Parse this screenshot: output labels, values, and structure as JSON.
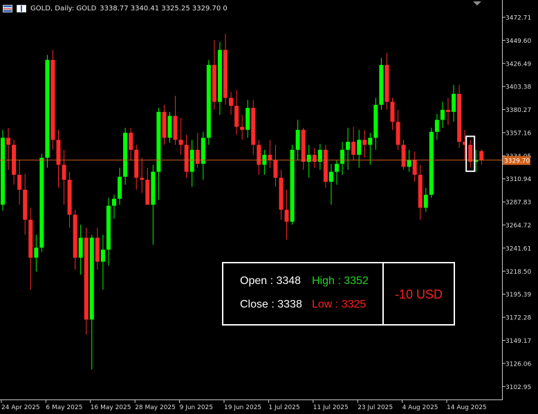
{
  "header": {
    "symbol_title": "GOLD, Daily:  GOLD",
    "ohlc_values": "3338.77 3340.41 3325.25 3329.70  0"
  },
  "colors": {
    "background": "#000000",
    "bull": "#00ff00",
    "bear": "#ff2a2a",
    "axis_text": "#dcdcdc",
    "price_line": "#d2601a",
    "price_tag_bg": "#d2601a"
  },
  "info_box": {
    "open_label": "Open : 3348",
    "high_label": "High : 3352",
    "close_label": "Close : 3338",
    "low_label": "Low : 3325",
    "pnl_label": "-10 USD"
  },
  "chart_data": {
    "type": "candlestick",
    "ylim": [
      3090,
      3490
    ],
    "y_ticks": [
      3472.71,
      3449.6,
      3426.49,
      3403.38,
      3380.27,
      3357.16,
      3334.05,
      3310.94,
      3287.83,
      3264.72,
      3241.61,
      3218.5,
      3195.39,
      3172.28,
      3149.17,
      3126.06,
      3102.95
    ],
    "x_tick_labels": [
      "24 Apr 2025",
      "6 May 2025",
      "16 May 2025",
      "28 May 2025",
      "9 Jun 2025",
      "19 Jun 2025",
      "1 Jul 2025",
      "11 Jul 2025",
      "23 Jul 2025",
      "4 Aug 2025",
      "14 Aug 2025"
    ],
    "x_tick_index": [
      0,
      8,
      16,
      24,
      32,
      40,
      48,
      56,
      64,
      72,
      80
    ],
    "current_price": 3329.7,
    "highlight_index": 84,
    "candles": [
      [
        3285,
        3360,
        3279,
        3352
      ],
      [
        3352,
        3362,
        3320,
        3345
      ],
      [
        3345,
        3350,
        3305,
        3315
      ],
      [
        3315,
        3330,
        3285,
        3300
      ],
      [
        3300,
        3316,
        3255,
        3270
      ],
      [
        3270,
        3282,
        3200,
        3232
      ],
      [
        3232,
        3255,
        3218,
        3242
      ],
      [
        3242,
        3336,
        3238,
        3332
      ],
      [
        3332,
        3435,
        3322,
        3430
      ],
      [
        3430,
        3440,
        3340,
        3350
      ],
      [
        3350,
        3360,
        3302,
        3325
      ],
      [
        3325,
        3340,
        3285,
        3310
      ],
      [
        3310,
        3318,
        3262,
        3275
      ],
      [
        3275,
        3280,
        3220,
        3232
      ],
      [
        3232,
        3265,
        3215,
        3252
      ],
      [
        3252,
        3262,
        3155,
        3170
      ],
      [
        3170,
        3255,
        3120,
        3252
      ],
      [
        3252,
        3262,
        3220,
        3228
      ],
      [
        3228,
        3255,
        3200,
        3240
      ],
      [
        3240,
        3292,
        3224,
        3284
      ],
      [
        3284,
        3295,
        3271,
        3291
      ],
      [
        3291,
        3322,
        3285,
        3313
      ],
      [
        3313,
        3362,
        3305,
        3357
      ],
      [
        3357,
        3362,
        3330,
        3340
      ],
      [
        3340,
        3345,
        3300,
        3312
      ],
      [
        3312,
        3332,
        3297,
        3310
      ],
      [
        3310,
        3322,
        3290,
        3285
      ],
      [
        3285,
        3325,
        3245,
        3318
      ],
      [
        3318,
        3382,
        3290,
        3378
      ],
      [
        3378,
        3385,
        3345,
        3352
      ],
      [
        3352,
        3378,
        3347,
        3374
      ],
      [
        3374,
        3394,
        3345,
        3350
      ],
      [
        3350,
        3372,
        3335,
        3345
      ],
      [
        3345,
        3355,
        3312,
        3318
      ],
      [
        3318,
        3350,
        3303,
        3340
      ],
      [
        3340,
        3357,
        3322,
        3326
      ],
      [
        3326,
        3358,
        3310,
        3352
      ],
      [
        3352,
        3430,
        3345,
        3425
      ],
      [
        3425,
        3450,
        3380,
        3388
      ],
      [
        3388,
        3448,
        3375,
        3440
      ],
      [
        3440,
        3456,
        3385,
        3392
      ],
      [
        3392,
        3398,
        3375,
        3384
      ],
      [
        3384,
        3400,
        3355,
        3363
      ],
      [
        3363,
        3375,
        3350,
        3360
      ],
      [
        3360,
        3390,
        3352,
        3382
      ],
      [
        3382,
        3390,
        3335,
        3345
      ],
      [
        3345,
        3350,
        3315,
        3325
      ],
      [
        3325,
        3340,
        3315,
        3335
      ],
      [
        3335,
        3350,
        3322,
        3330
      ],
      [
        3330,
        3345,
        3303,
        3312
      ],
      [
        3312,
        3320,
        3270,
        3280
      ],
      [
        3280,
        3300,
        3250,
        3268
      ],
      [
        3268,
        3345,
        3265,
        3340
      ],
      [
        3340,
        3370,
        3330,
        3360
      ],
      [
        3360,
        3362,
        3320,
        3328
      ],
      [
        3328,
        3345,
        3312,
        3335
      ],
      [
        3335,
        3342,
        3322,
        3328
      ],
      [
        3328,
        3346,
        3320,
        3340
      ],
      [
        3340,
        3345,
        3302,
        3308
      ],
      [
        3308,
        3326,
        3285,
        3318
      ],
      [
        3318,
        3330,
        3305,
        3326
      ],
      [
        3326,
        3348,
        3315,
        3340
      ],
      [
        3340,
        3362,
        3320,
        3348
      ],
      [
        3348,
        3363,
        3330,
        3335
      ],
      [
        3335,
        3360,
        3322,
        3350
      ],
      [
        3350,
        3360,
        3332,
        3345
      ],
      [
        3345,
        3357,
        3325,
        3352
      ],
      [
        3352,
        3392,
        3340,
        3385
      ],
      [
        3385,
        3432,
        3380,
        3425
      ],
      [
        3425,
        3437,
        3380,
        3388
      ],
      [
        3388,
        3392,
        3360,
        3368
      ],
      [
        3368,
        3380,
        3340,
        3345
      ],
      [
        3345,
        3350,
        3320,
        3323
      ],
      [
        3323,
        3340,
        3318,
        3330
      ],
      [
        3330,
        3338,
        3308,
        3315
      ],
      [
        3315,
        3325,
        3270,
        3282
      ],
      [
        3282,
        3302,
        3278,
        3295
      ],
      [
        3295,
        3362,
        3292,
        3358
      ],
      [
        3358,
        3376,
        3350,
        3370
      ],
      [
        3370,
        3388,
        3362,
        3380
      ],
      [
        3380,
        3392,
        3365,
        3378
      ],
      [
        3378,
        3405,
        3368,
        3396
      ],
      [
        3396,
        3405,
        3342,
        3348
      ],
      [
        3348,
        3360,
        3330,
        3345
      ],
      [
        3345,
        3350,
        3322,
        3328
      ],
      [
        3328,
        3340,
        3318,
        3330
      ],
      [
        3338.77,
        3340.41,
        3325.25,
        3329.7
      ]
    ]
  }
}
